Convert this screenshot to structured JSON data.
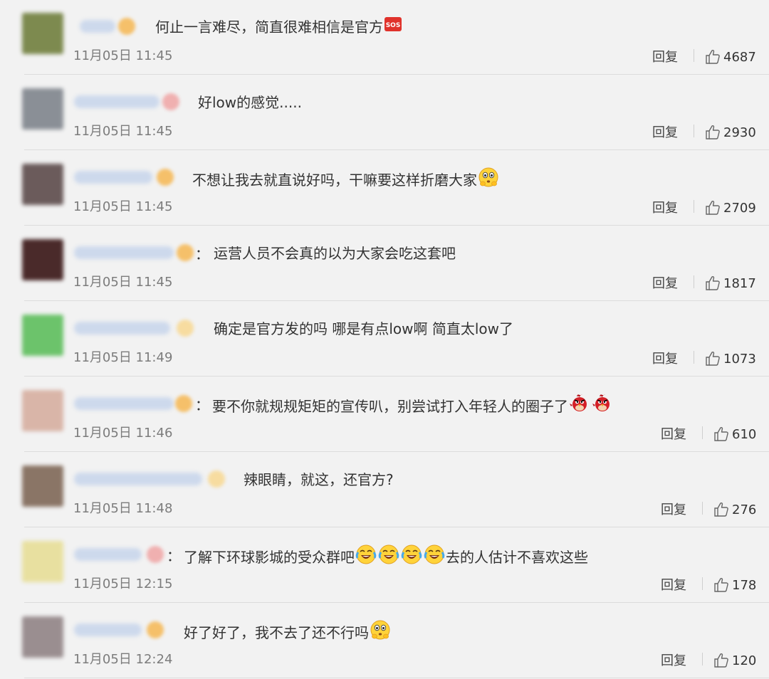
{
  "reply_label": "回复",
  "comments": [
    {
      "text": "何止一言难尽，简直很难相信是官方",
      "emojis_after": [
        "sos-icon"
      ],
      "timestamp": "11月05日 11:45",
      "likes": "4687",
      "avatar_color": "#7d8a4f",
      "badge_color": "#f5c06a"
    },
    {
      "text": "好low的感觉.....",
      "emojis_after": [],
      "timestamp": "11月05日 11:45",
      "likes": "2930",
      "avatar_color": "#8a8f96",
      "badge_color": "#f0b0b0"
    },
    {
      "text": "不想让我去就直说好吗，干嘛要这样折磨大家",
      "emojis_after": [
        "scared-face-icon"
      ],
      "timestamp": "11月05日 11:45",
      "likes": "2709",
      "avatar_color": "#6b5b5b",
      "badge_color": "#f5c06a"
    },
    {
      "text": "运营人员不会真的以为大家会吃这套吧",
      "emojis_after": [],
      "timestamp": "11月05日 11:45",
      "likes": "1817",
      "avatar_color": "#4a2a2a",
      "badge_color": "#f5c06a",
      "colon": "："
    },
    {
      "text": "确定是官方发的吗 哪是有点low啊 简直太low了",
      "emojis_after": [],
      "timestamp": "11月05日 11:49",
      "likes": "1073",
      "avatar_color": "#6cc36b",
      "badge_color": "#f7dca0"
    },
    {
      "text": "要不你就规规矩矩的宣传叭，别尝试打入年轻人的圈子了",
      "emojis_after": [
        "angry-bird-icon",
        "angry-bird-icon"
      ],
      "timestamp": "11月05日 11:46",
      "likes": "610",
      "avatar_color": "#d9b5a8",
      "badge_color": "#f5c06a",
      "colon": "："
    },
    {
      "text": "辣眼睛，就这，还官方?",
      "emojis_after": [],
      "timestamp": "11月05日 11:48",
      "likes": "276",
      "avatar_color": "#8a7566",
      "badge_color": "#f7dca0"
    },
    {
      "text": "了解下环球影城的受众群吧",
      "emojis_after": [
        "laugh-cry-icon",
        "laugh-cry-icon",
        "laugh-cry-icon",
        "laugh-cry-icon"
      ],
      "text_after": "去的人估计不喜欢这些",
      "timestamp": "11月05日 12:15",
      "likes": "178",
      "avatar_color": "#e8e0a0",
      "badge_color": "#f0b0b0",
      "colon": "："
    },
    {
      "text": "好了好了，我不去了还不行吗",
      "emojis_after": [
        "scared-face-icon"
      ],
      "timestamp": "11月05日 12:24",
      "likes": "120",
      "avatar_color": "#9a8e90",
      "badge_color": "#f5c06a"
    }
  ]
}
